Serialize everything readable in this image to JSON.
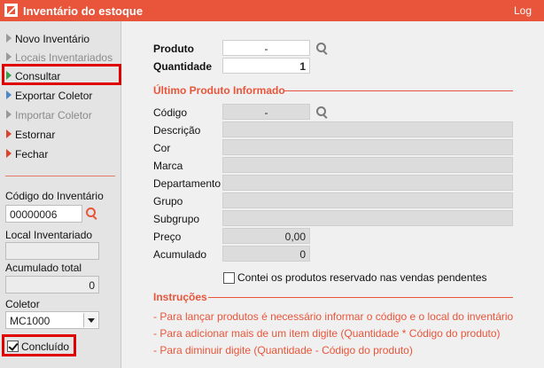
{
  "colors": {
    "accent": "#e8553a",
    "search_icon_main": "#7a7a7a",
    "search_icon_side": "#e8553a"
  },
  "titlebar": {
    "title": "Inventário do estoque",
    "log": "Log"
  },
  "sidebar": {
    "menu": [
      {
        "label": "Novo Inventário",
        "arrow": "gray",
        "enabled": true
      },
      {
        "label": "Locais Inventariados",
        "arrow": "gray",
        "enabled": false
      },
      {
        "label": "Consultar",
        "arrow": "green",
        "enabled": true
      },
      {
        "label": "Exportar Coletor",
        "arrow": "blue",
        "enabled": true
      },
      {
        "label": "Importar Coletor",
        "arrow": "gray",
        "enabled": false
      },
      {
        "label": "Estornar",
        "arrow": "red",
        "enabled": true
      },
      {
        "label": "Fechar",
        "arrow": "red",
        "enabled": true
      }
    ],
    "codigo_label": "Código do Inventário",
    "codigo_value": "00000006",
    "local_label": "Local Inventariado",
    "local_value": "",
    "acumulado_label": "Acumulado total",
    "acumulado_value": "0",
    "coletor_label": "Coletor",
    "coletor_value": "MC1000",
    "concluido_label": "Concluído",
    "concluido_checked": true
  },
  "main": {
    "produto_label": "Produto",
    "produto_value": "-",
    "quantidade_label": "Quantidade",
    "quantidade_value": "1",
    "ultimo_title": "Último Produto Informado",
    "codigo_label": "Código",
    "codigo_value": "-",
    "descricao_label": "Descrição",
    "cor_label": "Cor",
    "marca_label": "Marca",
    "departamento_label": "Departamento",
    "grupo_label": "Grupo",
    "subgrupo_label": "Subgrupo",
    "preco_label": "Preço",
    "preco_value": "0,00",
    "acumulado_label": "Acumulado",
    "acumulado_value": "0",
    "contei_label": "Contei os produtos reservado nas vendas pendentes",
    "contei_checked": false,
    "instrucoes_title": "Instruções",
    "instrucoes": [
      "- Para lançar produtos é necessário informar o código e o local do inventário",
      "- Para adicionar mais de um item digite (Quantidade * Código do produto)",
      "- Para diminuir digite (Quantidade - Código do produto)"
    ]
  }
}
